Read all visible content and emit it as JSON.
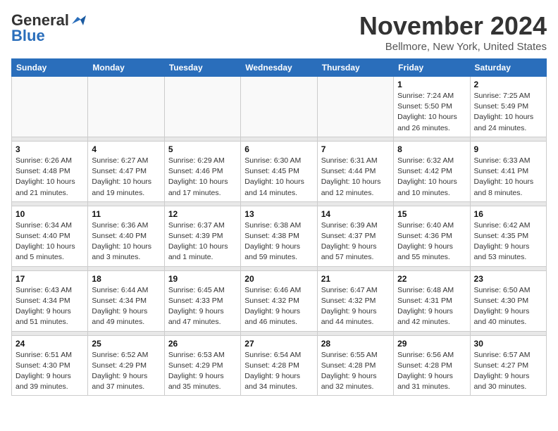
{
  "logo": {
    "general": "General",
    "blue": "Blue"
  },
  "header": {
    "month": "November 2024",
    "location": "Bellmore, New York, United States"
  },
  "weekdays": [
    "Sunday",
    "Monday",
    "Tuesday",
    "Wednesday",
    "Thursday",
    "Friday",
    "Saturday"
  ],
  "weeks": [
    [
      {
        "day": "",
        "info": ""
      },
      {
        "day": "",
        "info": ""
      },
      {
        "day": "",
        "info": ""
      },
      {
        "day": "",
        "info": ""
      },
      {
        "day": "",
        "info": ""
      },
      {
        "day": "1",
        "info": "Sunrise: 7:24 AM\nSunset: 5:50 PM\nDaylight: 10 hours\nand 26 minutes."
      },
      {
        "day": "2",
        "info": "Sunrise: 7:25 AM\nSunset: 5:49 PM\nDaylight: 10 hours\nand 24 minutes."
      }
    ],
    [
      {
        "day": "3",
        "info": "Sunrise: 6:26 AM\nSunset: 4:48 PM\nDaylight: 10 hours\nand 21 minutes."
      },
      {
        "day": "4",
        "info": "Sunrise: 6:27 AM\nSunset: 4:47 PM\nDaylight: 10 hours\nand 19 minutes."
      },
      {
        "day": "5",
        "info": "Sunrise: 6:29 AM\nSunset: 4:46 PM\nDaylight: 10 hours\nand 17 minutes."
      },
      {
        "day": "6",
        "info": "Sunrise: 6:30 AM\nSunset: 4:45 PM\nDaylight: 10 hours\nand 14 minutes."
      },
      {
        "day": "7",
        "info": "Sunrise: 6:31 AM\nSunset: 4:44 PM\nDaylight: 10 hours\nand 12 minutes."
      },
      {
        "day": "8",
        "info": "Sunrise: 6:32 AM\nSunset: 4:42 PM\nDaylight: 10 hours\nand 10 minutes."
      },
      {
        "day": "9",
        "info": "Sunrise: 6:33 AM\nSunset: 4:41 PM\nDaylight: 10 hours\nand 8 minutes."
      }
    ],
    [
      {
        "day": "10",
        "info": "Sunrise: 6:34 AM\nSunset: 4:40 PM\nDaylight: 10 hours\nand 5 minutes."
      },
      {
        "day": "11",
        "info": "Sunrise: 6:36 AM\nSunset: 4:40 PM\nDaylight: 10 hours\nand 3 minutes."
      },
      {
        "day": "12",
        "info": "Sunrise: 6:37 AM\nSunset: 4:39 PM\nDaylight: 10 hours\nand 1 minute."
      },
      {
        "day": "13",
        "info": "Sunrise: 6:38 AM\nSunset: 4:38 PM\nDaylight: 9 hours\nand 59 minutes."
      },
      {
        "day": "14",
        "info": "Sunrise: 6:39 AM\nSunset: 4:37 PM\nDaylight: 9 hours\nand 57 minutes."
      },
      {
        "day": "15",
        "info": "Sunrise: 6:40 AM\nSunset: 4:36 PM\nDaylight: 9 hours\nand 55 minutes."
      },
      {
        "day": "16",
        "info": "Sunrise: 6:42 AM\nSunset: 4:35 PM\nDaylight: 9 hours\nand 53 minutes."
      }
    ],
    [
      {
        "day": "17",
        "info": "Sunrise: 6:43 AM\nSunset: 4:34 PM\nDaylight: 9 hours\nand 51 minutes."
      },
      {
        "day": "18",
        "info": "Sunrise: 6:44 AM\nSunset: 4:34 PM\nDaylight: 9 hours\nand 49 minutes."
      },
      {
        "day": "19",
        "info": "Sunrise: 6:45 AM\nSunset: 4:33 PM\nDaylight: 9 hours\nand 47 minutes."
      },
      {
        "day": "20",
        "info": "Sunrise: 6:46 AM\nSunset: 4:32 PM\nDaylight: 9 hours\nand 46 minutes."
      },
      {
        "day": "21",
        "info": "Sunrise: 6:47 AM\nSunset: 4:32 PM\nDaylight: 9 hours\nand 44 minutes."
      },
      {
        "day": "22",
        "info": "Sunrise: 6:48 AM\nSunset: 4:31 PM\nDaylight: 9 hours\nand 42 minutes."
      },
      {
        "day": "23",
        "info": "Sunrise: 6:50 AM\nSunset: 4:30 PM\nDaylight: 9 hours\nand 40 minutes."
      }
    ],
    [
      {
        "day": "24",
        "info": "Sunrise: 6:51 AM\nSunset: 4:30 PM\nDaylight: 9 hours\nand 39 minutes."
      },
      {
        "day": "25",
        "info": "Sunrise: 6:52 AM\nSunset: 4:29 PM\nDaylight: 9 hours\nand 37 minutes."
      },
      {
        "day": "26",
        "info": "Sunrise: 6:53 AM\nSunset: 4:29 PM\nDaylight: 9 hours\nand 35 minutes."
      },
      {
        "day": "27",
        "info": "Sunrise: 6:54 AM\nSunset: 4:28 PM\nDaylight: 9 hours\nand 34 minutes."
      },
      {
        "day": "28",
        "info": "Sunrise: 6:55 AM\nSunset: 4:28 PM\nDaylight: 9 hours\nand 32 minutes."
      },
      {
        "day": "29",
        "info": "Sunrise: 6:56 AM\nSunset: 4:28 PM\nDaylight: 9 hours\nand 31 minutes."
      },
      {
        "day": "30",
        "info": "Sunrise: 6:57 AM\nSunset: 4:27 PM\nDaylight: 9 hours\nand 30 minutes."
      }
    ]
  ]
}
